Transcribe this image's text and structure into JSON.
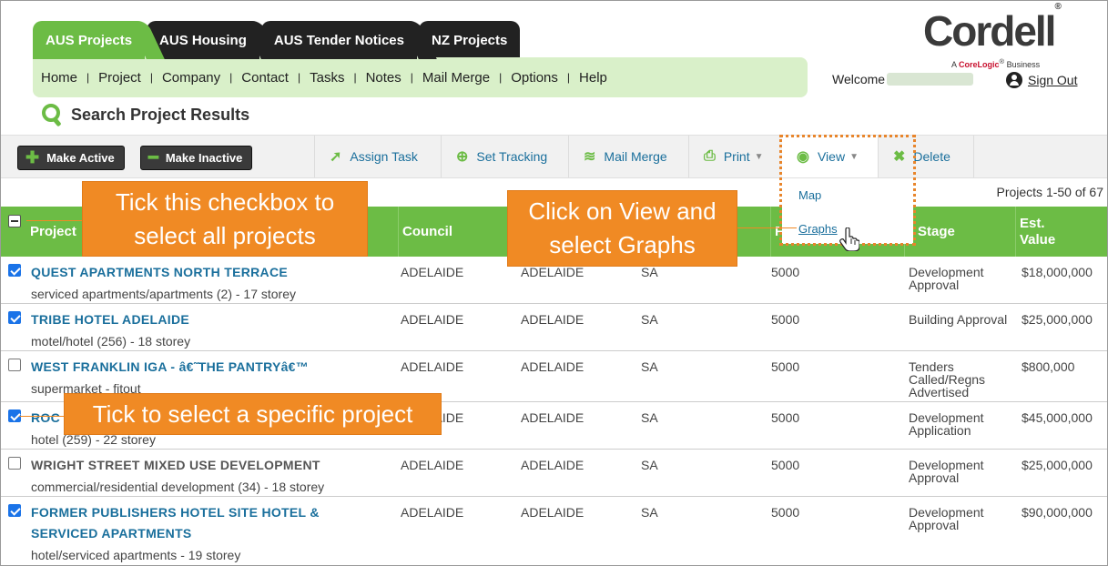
{
  "tabs": [
    "AUS Projects",
    "AUS Housing",
    "AUS Tender Notices",
    "NZ Projects"
  ],
  "nav": [
    "Home",
    "Project",
    "Company",
    "Contact",
    "Tasks",
    "Notes",
    "Mail Merge",
    "Options",
    "Help"
  ],
  "nav_separator": "|",
  "brand": {
    "name": "Cordell",
    "registered": "®",
    "tagline_prefix": "A",
    "tagline_company": "CoreLogic",
    "tagline_suffix": "Business"
  },
  "user": {
    "welcome": "Welcome",
    "sign_out": "Sign Out"
  },
  "page_title": "Search Project Results",
  "toolbar": {
    "make_active": "Make Active",
    "make_inactive": "Make Inactive",
    "assign_task": "Assign Task",
    "set_tracking": "Set Tracking",
    "mail_merge": "Mail Merge",
    "print": "Print",
    "view": "View",
    "delete": "Delete"
  },
  "view_menu": [
    "Map",
    "Graphs"
  ],
  "results_info": "Projects 1-50 of 67",
  "columns": {
    "project": "Project",
    "council": "Council",
    "f": "F",
    "stage": "Stage",
    "est_value_line1": "Est.",
    "est_value_line2": "Value"
  },
  "rows": [
    {
      "name": "QUEST APARTMENTS NORTH TERRACE",
      "desc": "serviced apartments/apartments (2) - 17 storey",
      "council": "ADELAIDE",
      "town": "ADELAIDE",
      "state": "SA",
      "postcode": "5000",
      "stage": "Development Approval",
      "value": "$18,000,000",
      "checked": true,
      "link": true
    },
    {
      "name": "TRIBE HOTEL ADELAIDE",
      "desc": "motel/hotel (256) - 18 storey",
      "council": "ADELAIDE",
      "town": "ADELAIDE",
      "state": "SA",
      "postcode": "5000",
      "stage": "Building Approval",
      "value": "$25,000,000",
      "checked": true,
      "link": true
    },
    {
      "name": "WEST FRANKLIN IGA - â€˜THE PANTRYâ€™",
      "desc": "supermarket - fitout",
      "council": "ADELAIDE",
      "town": "ADELAIDE",
      "state": "SA",
      "postcode": "5000",
      "stage": "Tenders Called/Regns Advertised",
      "value": "$800,000",
      "checked": false,
      "link": true
    },
    {
      "name": "ROC",
      "desc": "hotel (259) - 22 storey",
      "council": "ADELAIDE",
      "town": "ADELAIDE",
      "state": "SA",
      "postcode": "5000",
      "stage": "Development Application",
      "value": "$45,000,000",
      "checked": true,
      "link": true
    },
    {
      "name": "WRIGHT STREET MIXED USE DEVELOPMENT",
      "desc": "commercial/residential development (34) - 18 storey",
      "council": "ADELAIDE",
      "town": "ADELAIDE",
      "state": "SA",
      "postcode": "5000",
      "stage": "Development Approval",
      "value": "$25,000,000",
      "checked": false,
      "link": false
    },
    {
      "name": "FORMER PUBLISHERS HOTEL SITE HOTEL & SERVICED APARTMENTS",
      "desc": "hotel/serviced apartments - 19 storey",
      "council": "ADELAIDE",
      "town": "ADELAIDE",
      "state": "SA",
      "postcode": "5000",
      "stage": "Development Approval",
      "value": "$90,000,000",
      "checked": true,
      "link": true
    }
  ],
  "callouts": {
    "select_all": "Tick this checkbox to select all projects",
    "view_graphs": "Click on View and select Graphs",
    "select_one": "Tick to select a specific project"
  },
  "colors": {
    "green": "#6cbc45",
    "light_green": "#d9f0c9",
    "orange": "#f08a24",
    "link_blue": "#1a6f9c"
  }
}
